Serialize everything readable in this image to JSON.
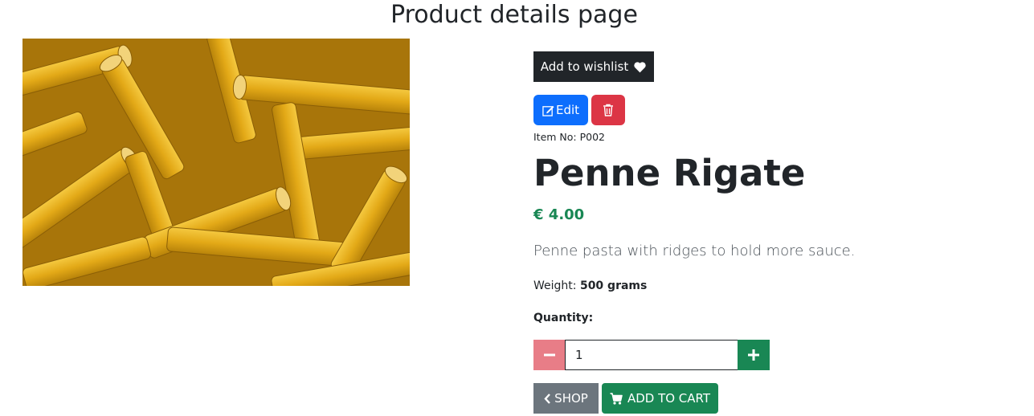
{
  "page": {
    "title": "Product details page"
  },
  "product": {
    "image_alt": "Penne pasta",
    "item_no": "Item No: P002",
    "name": "Penne Rigate",
    "price": "€ 4.00",
    "description": "Penne pasta with ridges to hold more sauce.",
    "weight_label": "Weight:",
    "weight_value": "500 grams"
  },
  "actions": {
    "wishlist_label": "Add to wishlist",
    "edit_label": "Edit",
    "delete_icon": "trash-icon",
    "shop_label": "SHOP",
    "add_to_cart_label": "ADD TO CART"
  },
  "quantity": {
    "label": "Quantity:",
    "value": "1"
  },
  "colors": {
    "wishlist_bg": "#212529",
    "edit_bg": "#0d6efd",
    "delete_bg": "#dc3545",
    "price": "#198754",
    "minus_bg": "#e87d87",
    "plus_bg": "#198754",
    "shop_bg": "#6c757d",
    "cart_bg": "#198754"
  }
}
